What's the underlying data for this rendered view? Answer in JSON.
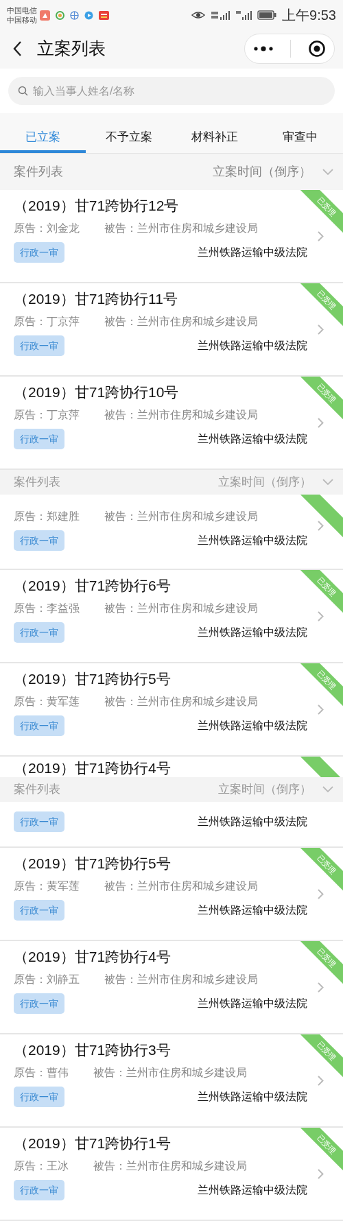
{
  "status_bar": {
    "carriers": [
      "中国电信",
      "中国移动"
    ],
    "time": "上午9:53"
  },
  "nav": {
    "title": "立案列表"
  },
  "search": {
    "placeholder": "输入当事人姓名/名称"
  },
  "tabs": [
    {
      "label": "已立案",
      "selected": true
    },
    {
      "label": "不予立案",
      "selected": false
    },
    {
      "label": "材料补正",
      "selected": false
    },
    {
      "label": "审查中",
      "selected": false
    }
  ],
  "list": [
    {
      "kind": "sort_bar",
      "label": "案件列表",
      "sort": "立案时间（倒序）"
    },
    {
      "kind": "case",
      "title": "（2019）甘71跨协行12号",
      "plaintiff": "原告：刘金龙",
      "defendant": "被告：兰州市住房和城乡建设局",
      "tag": "行政一审",
      "court": "兰州铁路运输中级法院",
      "status": "已受理"
    },
    {
      "kind": "case",
      "title": "（2019）甘71跨协行11号",
      "plaintiff": "原告：丁京萍",
      "defendant": "被告：兰州市住房和城乡建设局",
      "tag": "行政一审",
      "court": "兰州铁路运输中级法院",
      "status": "已受理"
    },
    {
      "kind": "case",
      "title": "（2019）甘71跨协行10号",
      "plaintiff": "原告：丁京萍",
      "defendant": "被告：兰州市住房和城乡建设局",
      "tag": "行政一审",
      "court": "兰州铁路运输中级法院",
      "status": "已受理"
    },
    {
      "kind": "sticky_bar",
      "label": "案件列表",
      "sort": "立案时间（倒序）"
    },
    {
      "kind": "case",
      "plaintiff": "原告：郑建胜",
      "defendant": "被告：兰州市住房和城乡建设局",
      "tag": "行政一审",
      "court": "兰州铁路运输中级法院"
    },
    {
      "kind": "case",
      "title": "（2019）甘71跨协行6号",
      "plaintiff": "原告：李益强",
      "defendant": "被告：兰州市住房和城乡建设局",
      "tag": "行政一审",
      "court": "兰州铁路运输中级法院",
      "status": "已受理"
    },
    {
      "kind": "case",
      "title": "（2019）甘71跨协行5号",
      "plaintiff": "原告：黄军莲",
      "defendant": "被告：兰州市住房和城乡建设局",
      "tag": "行政一审",
      "court": "兰州铁路运输中级法院",
      "status": "已受理"
    },
    {
      "kind": "case_top",
      "title": "（2019）甘71跨协行4号"
    },
    {
      "kind": "sticky_bar",
      "label": "案件列表",
      "sort": "立案时间（倒序）"
    },
    {
      "kind": "case_bottom",
      "tag": "行政一审",
      "court": "兰州铁路运输中级法院"
    },
    {
      "kind": "case",
      "title": "（2019）甘71跨协行5号",
      "plaintiff": "原告：黄军莲",
      "defendant": "被告：兰州市住房和城乡建设局",
      "tag": "行政一审",
      "court": "兰州铁路运输中级法院",
      "status": "已受理"
    },
    {
      "kind": "case",
      "title": "（2019）甘71跨协行4号",
      "plaintiff": "原告：刘静五",
      "defendant": "被告：兰州市住房和城乡建设局",
      "tag": "行政一审",
      "court": "兰州铁路运输中级法院",
      "status": "已受理"
    },
    {
      "kind": "case",
      "title": "（2019）甘71跨协行3号",
      "plaintiff": "原告：曹伟",
      "defendant": "被告：兰州市住房和城乡建设局",
      "tag": "行政一审",
      "court": "兰州铁路运输中级法院",
      "status": "已受理"
    },
    {
      "kind": "case",
      "title": "（2019）甘71跨协行1号",
      "plaintiff": "原告：王冰",
      "defendant": "被告：兰州市住房和城乡建设局",
      "tag": "行政一审",
      "court": "兰州铁路运输中级法院",
      "status": "已受理"
    }
  ]
}
